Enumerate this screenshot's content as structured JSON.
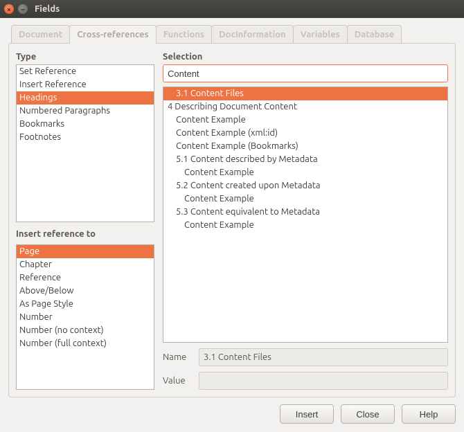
{
  "window": {
    "title": "Fields"
  },
  "tabs": {
    "items": [
      {
        "label": "Document"
      },
      {
        "label": "Cross-references"
      },
      {
        "label": "Functions"
      },
      {
        "label": "DocInformation"
      },
      {
        "label": "Variables"
      },
      {
        "label": "Database"
      }
    ],
    "active_index": 1
  },
  "labels": {
    "type": "Type",
    "insert_ref": "Insert reference to",
    "selection": "Selection",
    "name": "Name",
    "value": "Value"
  },
  "type_list": {
    "items": [
      "Set Reference",
      "Insert Reference",
      "Headings",
      "Numbered Paragraphs",
      "Bookmarks",
      "Footnotes"
    ],
    "selected_index": 2
  },
  "insert_ref_list": {
    "items": [
      "Page",
      "Chapter",
      "Reference",
      "Above/Below",
      "As Page Style",
      "Number",
      "Number (no context)",
      "Number (full context)"
    ],
    "selected_index": 0
  },
  "filter": {
    "value": "Content"
  },
  "selection_list": {
    "items": [
      {
        "text": "3.1 Content Files",
        "indent": 1,
        "selected": true
      },
      {
        "text": "4 Describing Document Content",
        "indent": 0
      },
      {
        "text": "Content Example",
        "indent": 1
      },
      {
        "text": "Content Example (xml:id)",
        "indent": 1
      },
      {
        "text": "Content Example (Bookmarks)",
        "indent": 1
      },
      {
        "text": "5.1 Content described by Metadata",
        "indent": 1
      },
      {
        "text": "Content Example",
        "indent": 2
      },
      {
        "text": "5.2 Content created upon Metadata",
        "indent": 1
      },
      {
        "text": "Content Example",
        "indent": 2
      },
      {
        "text": "5.3 Content equivalent to Metadata",
        "indent": 1
      },
      {
        "text": "Content Example",
        "indent": 2
      }
    ]
  },
  "name_field": {
    "value": "3.1 Content Files"
  },
  "value_field": {
    "value": ""
  },
  "buttons": {
    "insert": "Insert",
    "close": "Close",
    "help": "Help"
  }
}
